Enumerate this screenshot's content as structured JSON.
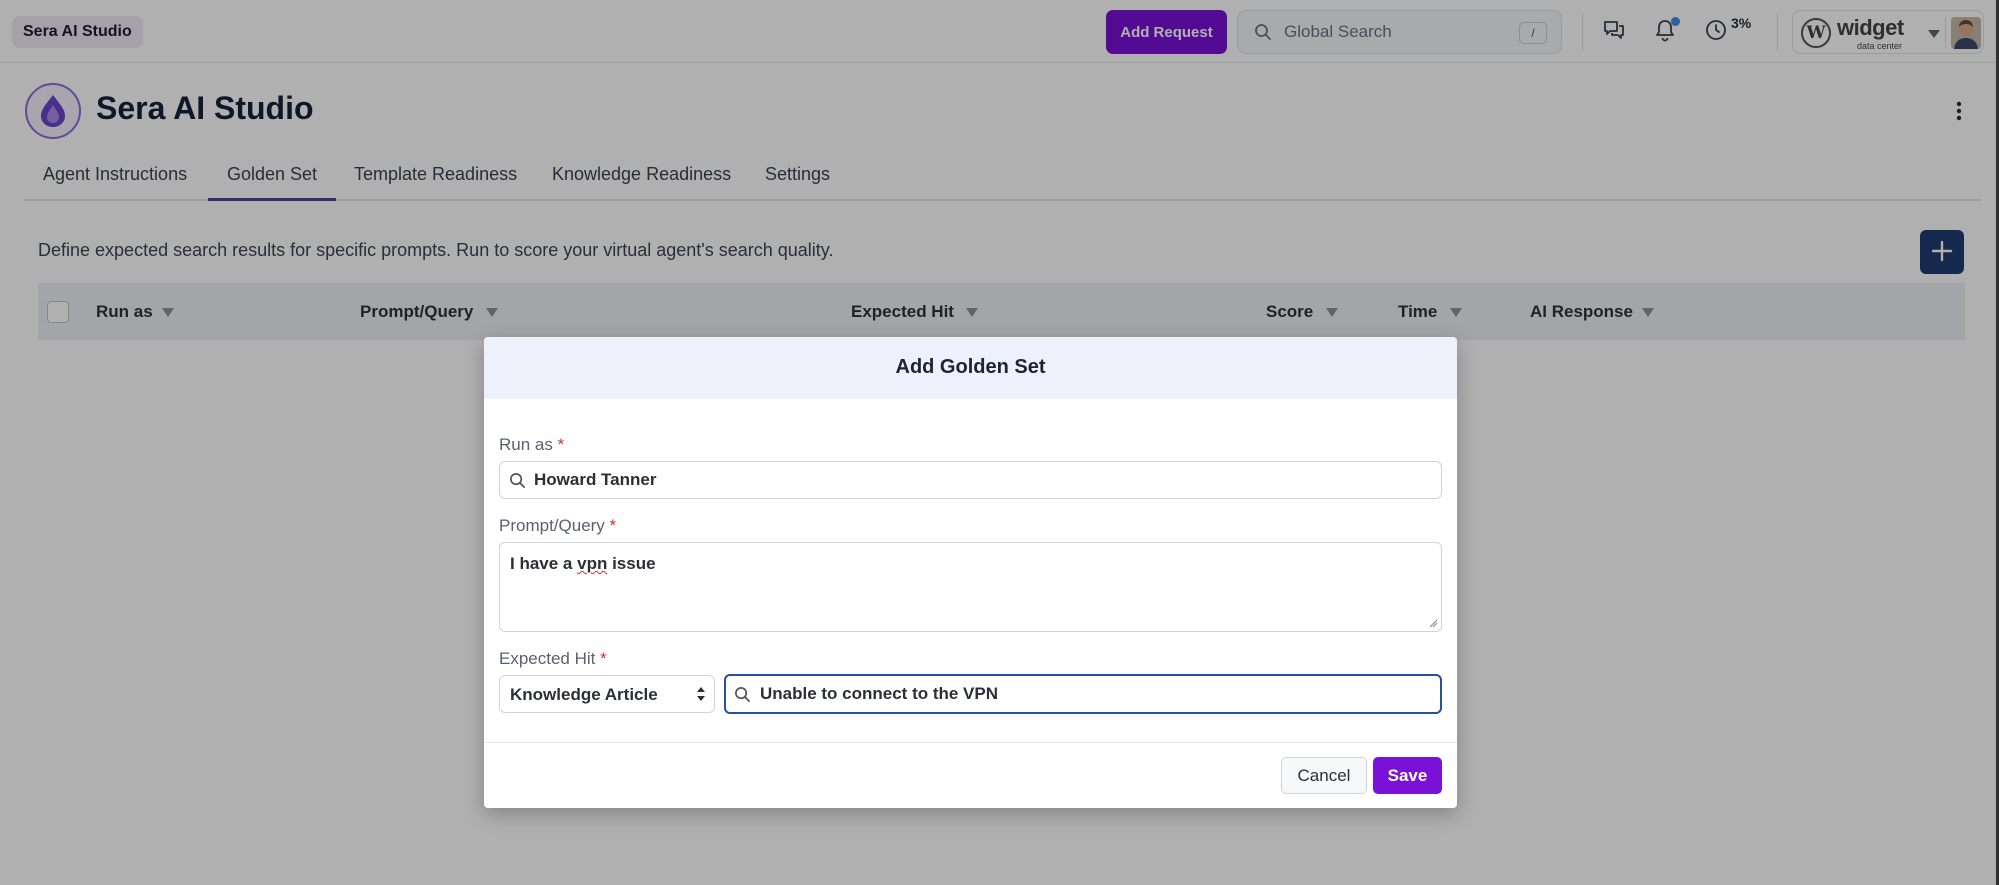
{
  "topbar": {
    "app_name": "Sera AI Studio",
    "add_request_label": "Add Request",
    "search_placeholder": "Global Search",
    "search_shortcut": "/",
    "usage_percent": "3%",
    "brand_name": "widget",
    "brand_subtitle": "data center"
  },
  "page": {
    "title": "Sera AI Studio",
    "tabs": [
      {
        "label": "Agent Instructions"
      },
      {
        "label": "Golden Set"
      },
      {
        "label": "Template Readiness"
      },
      {
        "label": "Knowledge Readiness"
      },
      {
        "label": "Settings"
      }
    ],
    "active_tab": "Golden Set",
    "description": "Define expected search results for specific prompts. Run to score your virtual agent's search quality."
  },
  "table": {
    "columns": [
      {
        "label": "Run as"
      },
      {
        "label": "Prompt/Query"
      },
      {
        "label": "Expected Hit"
      },
      {
        "label": "Score"
      },
      {
        "label": "Time"
      },
      {
        "label": "AI Response"
      }
    ],
    "rows": []
  },
  "modal": {
    "title": "Add Golden Set",
    "run_as": {
      "label": "Run as",
      "required_mark": "*",
      "value": "Howard Tanner"
    },
    "prompt": {
      "label": "Prompt/Query",
      "required_mark": "*",
      "value_before": "I have a ",
      "value_misspelled": "vpn",
      "value_after": " issue"
    },
    "expected_hit": {
      "label": "Expected Hit",
      "required_mark": "*",
      "type_value": "Knowledge Article",
      "value": "Unable to connect to the VPN"
    },
    "cancel_label": "Cancel",
    "save_label": "Save"
  },
  "colors": {
    "primary": "#7a11d6",
    "fab": "#1f3a70",
    "focus_border": "#2a4fa0",
    "required": "#d62f2f"
  }
}
